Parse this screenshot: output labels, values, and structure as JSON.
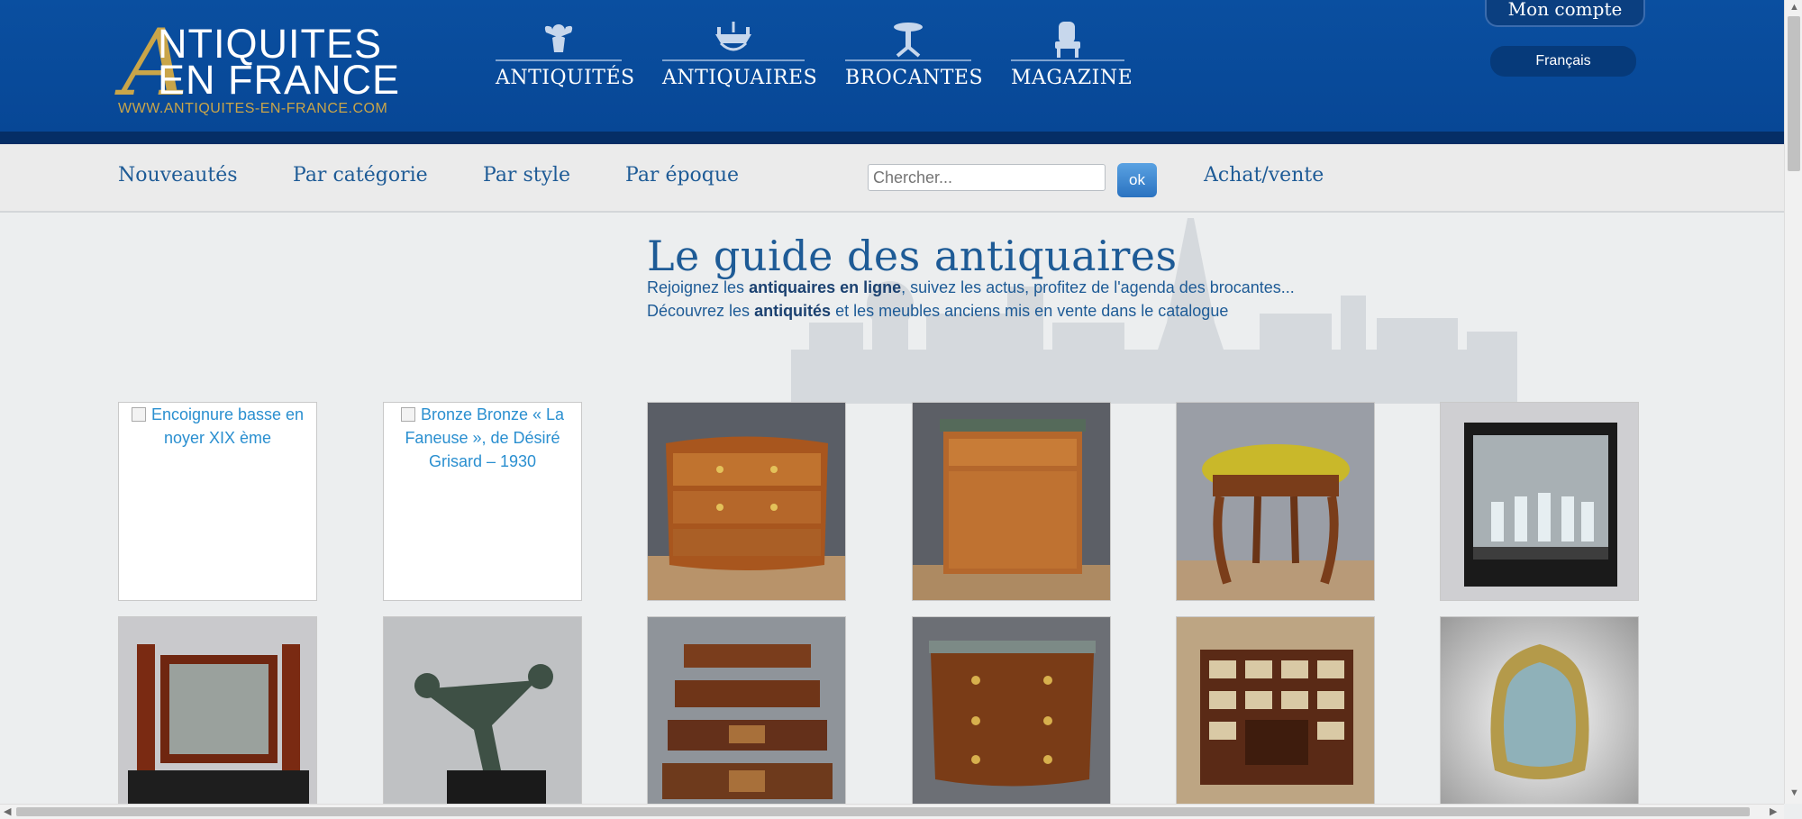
{
  "logo": {
    "initial": "A",
    "line1": "NTIQUITES",
    "line2": "EN FRANCE",
    "url": "WWW.ANTIQUITES-EN-FRANCE.COM"
  },
  "topnav": [
    {
      "label": "ANTIQUITÉS",
      "icon": "cherub-icon"
    },
    {
      "label": "ANTIQUAIRES",
      "icon": "chandelier-icon"
    },
    {
      "label": "BROCANTES",
      "icon": "pedestal-table-icon"
    },
    {
      "label": "MAGAZINE",
      "icon": "armchair-icon"
    }
  ],
  "account": {
    "label": "Mon compte",
    "language": "Français"
  },
  "subnav": {
    "links": [
      "Nouveautés",
      "Par catégorie",
      "Par style",
      "Par époque"
    ],
    "search_placeholder": "Chercher...",
    "search_button": "ok",
    "buy_sell": "Achat/vente"
  },
  "hero": {
    "title": "Le guide des antiquaires",
    "line1_pre": "Rejoignez les ",
    "line1_bold": "antiquaires en ligne",
    "line1_post": ", suivez les actus, profitez de l'agenda des brocantes...",
    "line2_pre": "Découvrez les ",
    "line2_bold": "antiquités",
    "line2_post": " et les meubles anciens mis en vente dans le catalogue"
  },
  "products": [
    {
      "alt": "Encoignure basse en noyer XIX ème",
      "type": "broken"
    },
    {
      "alt": "Bronze Bronze « La Faneuse », de Désiré Grisard – 1930",
      "type": "broken"
    },
    {
      "type": "commode-bombee-icon"
    },
    {
      "type": "secretaire-icon"
    },
    {
      "type": "tabouret-icon"
    },
    {
      "type": "cave-a-liqueur-icon"
    },
    {
      "type": "miroir-psyche-icon"
    },
    {
      "type": "bronze-danseuse-icon"
    },
    {
      "type": "tables-gigognes-icon"
    },
    {
      "type": "commode-galbee-icon"
    },
    {
      "type": "cabinet-icon"
    },
    {
      "type": "miroir-dore-icon"
    }
  ],
  "colors": {
    "header": "#0a4fa0",
    "accent_gold": "#c9a549",
    "link": "#1e5b96",
    "subnav_bg": "#ebebeb"
  }
}
